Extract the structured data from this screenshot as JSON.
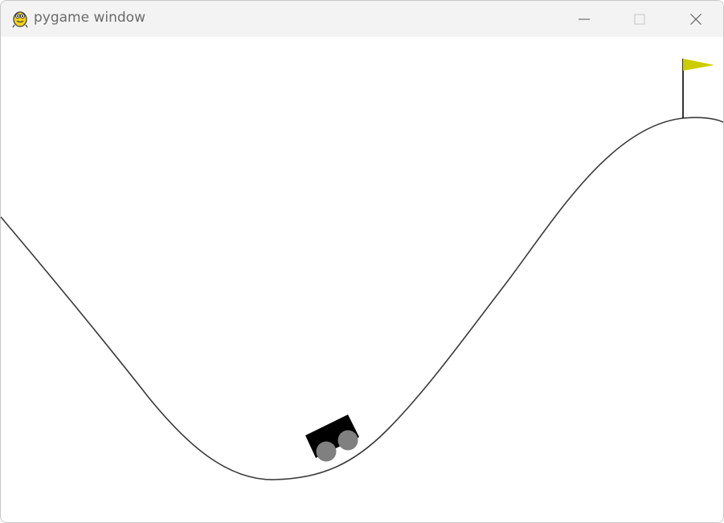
{
  "window": {
    "title": "pygame window",
    "controls": {
      "minimize": "minimize-icon",
      "maximize": "maximize-icon",
      "close": "close-icon"
    }
  },
  "scene": {
    "car_color": "#000000",
    "wheel_color": "#808080",
    "flag_color": "#cccc00",
    "track_color": "#333333",
    "background_color": "#ffffff"
  }
}
